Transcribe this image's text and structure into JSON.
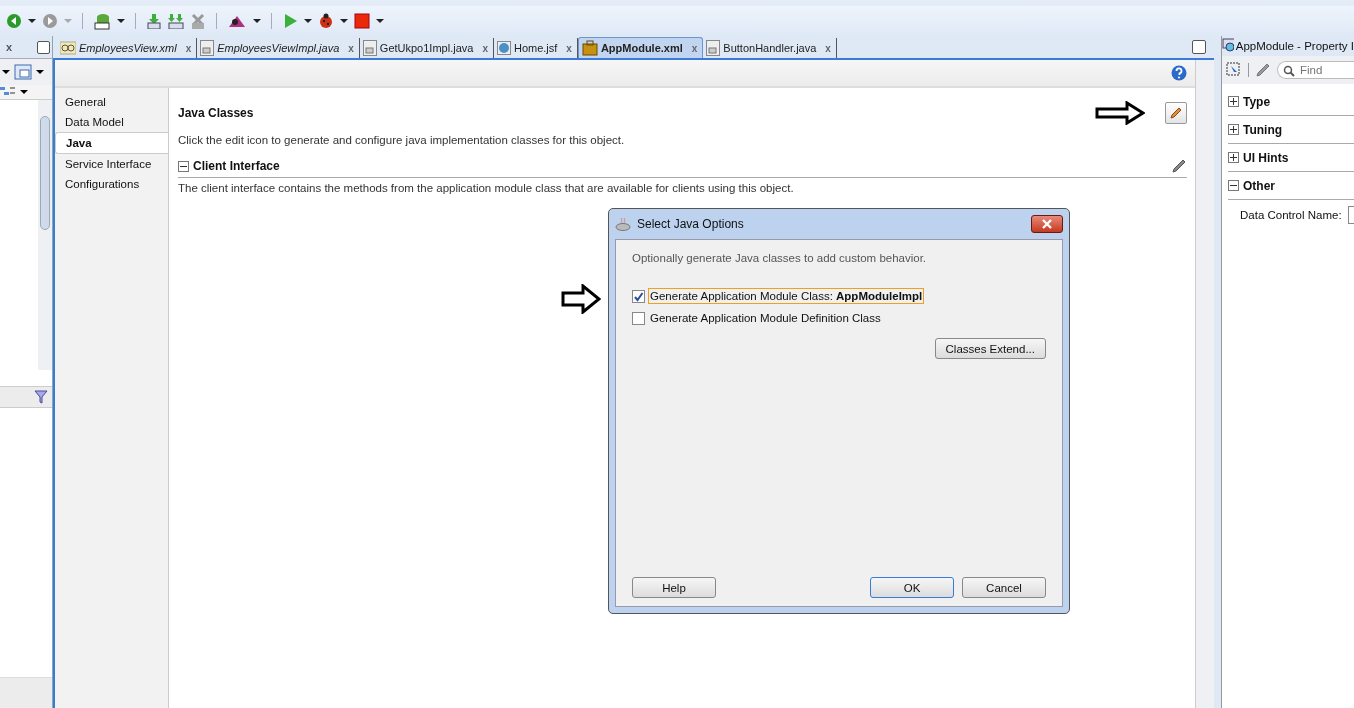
{
  "left_panel": {
    "close": "x"
  },
  "tabs": [
    {
      "label": "EmployeesView.xml",
      "kind": "xml",
      "italic": true,
      "selected": false,
      "close": "x"
    },
    {
      "label": "EmployeesViewImpl.java",
      "kind": "java",
      "italic": true,
      "selected": false,
      "close": "x"
    },
    {
      "label": "GetUkpo1Impl.java",
      "kind": "java",
      "italic": false,
      "selected": false,
      "close": "x"
    },
    {
      "label": "Home.jsf",
      "kind": "web",
      "italic": false,
      "selected": false,
      "close": "x"
    },
    {
      "label": "AppModule.xml",
      "kind": "module",
      "italic": false,
      "selected": true,
      "close": "x"
    },
    {
      "label": "ButtonHandler.java",
      "kind": "java",
      "italic": false,
      "selected": false,
      "close": "x"
    }
  ],
  "editor": {
    "nav": [
      {
        "label": "General",
        "selected": false
      },
      {
        "label": "Data Model",
        "selected": false
      },
      {
        "label": "Java",
        "selected": true
      },
      {
        "label": "Service Interface",
        "selected": false
      },
      {
        "label": "Configurations",
        "selected": false
      }
    ],
    "section_title": "Java Classes",
    "section_description": "Click the edit icon to generate and configure java implementation classes for this object.",
    "client_interface": {
      "title": "Client Interface",
      "expanded": true,
      "description": "The client interface contains the methods from the application module class that are available for clients using this object."
    }
  },
  "dialog": {
    "title": "Select Java Options",
    "intro": "Optionally generate Java classes to add custom behavior.",
    "options": [
      {
        "label": "Generate Application Module Class: **AppModuleImpl**",
        "checked": true,
        "focused": true
      },
      {
        "label": "Generate Application Module Definition Class",
        "checked": false,
        "focused": false
      }
    ],
    "extend_button": "Classes Extend...",
    "buttons": [
      {
        "label": "Help",
        "default": false
      },
      {
        "label": "OK",
        "default": true
      },
      {
        "label": "Cancel",
        "default": false
      }
    ]
  },
  "property_inspector": {
    "title": "AppModule - Property I",
    "search": {
      "placeholder": "Find"
    },
    "sections": [
      {
        "label": "Type",
        "expanded": false
      },
      {
        "label": "Tuning",
        "expanded": false
      },
      {
        "label": "UI Hints",
        "expanded": false
      },
      {
        "label": "Other",
        "expanded": true
      }
    ],
    "fields": [
      {
        "label": "Data Control Name:"
      }
    ]
  }
}
